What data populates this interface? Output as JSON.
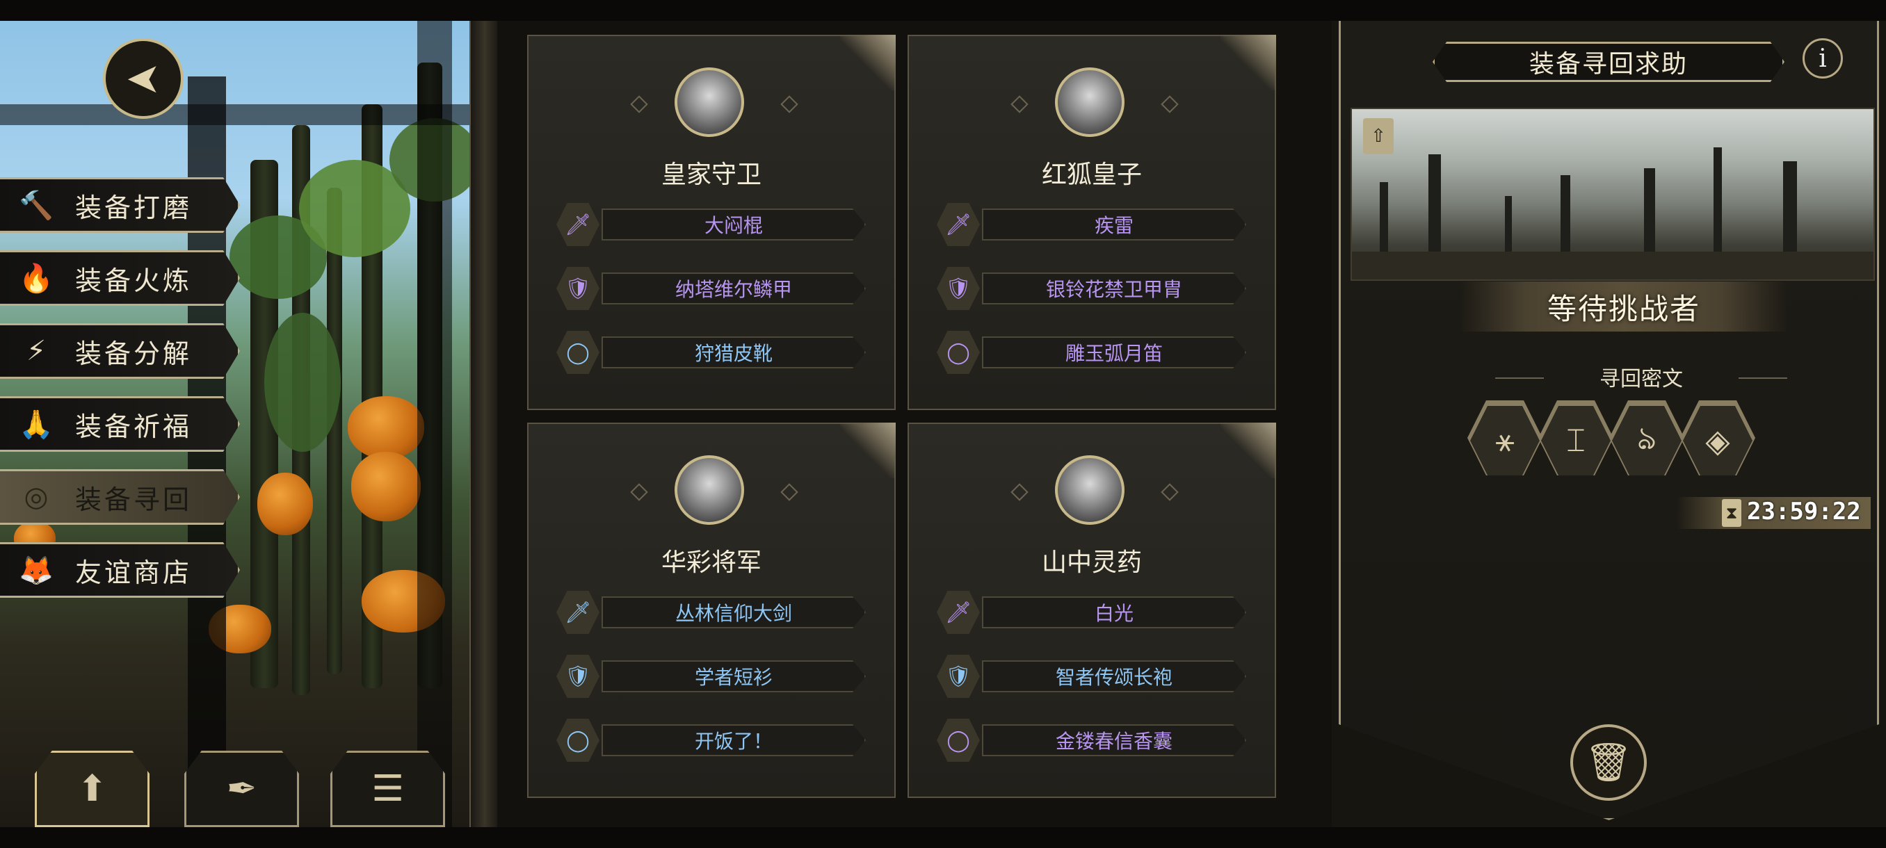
{
  "menu": {
    "items": [
      {
        "label": "装备打磨",
        "icon": "hammer-icon",
        "glyph": "🔨",
        "active": false
      },
      {
        "label": "装备火炼",
        "icon": "flame-icon",
        "glyph": "🔥",
        "active": false
      },
      {
        "label": "装备分解",
        "icon": "decompose-icon",
        "glyph": "⚡",
        "active": false
      },
      {
        "label": "装备祈福",
        "icon": "pray-icon",
        "glyph": "🙏",
        "active": false
      },
      {
        "label": "装备寻回",
        "icon": "target-icon",
        "glyph": "◎",
        "active": true
      },
      {
        "label": "友谊商店",
        "icon": "fox-icon",
        "glyph": "🦊",
        "active": false
      }
    ]
  },
  "back_glyph": "➤",
  "cards": [
    {
      "name": "皇家守卫",
      "items": [
        {
          "label": "大闷棍",
          "type": "weapon",
          "glyph": "🗡",
          "color": "purple"
        },
        {
          "label": "纳塔维尔鳞甲",
          "type": "armor",
          "glyph": "🛡",
          "color": "purple"
        },
        {
          "label": "狩猎皮靴",
          "type": "accessory",
          "glyph": "◯",
          "color": "blue"
        }
      ]
    },
    {
      "name": "红狐皇子",
      "items": [
        {
          "label": "疾雷",
          "type": "weapon",
          "glyph": "🗡",
          "color": "purple"
        },
        {
          "label": "银铃花禁卫甲胄",
          "type": "armor",
          "glyph": "🛡",
          "color": "purple"
        },
        {
          "label": "雕玉弧月笛",
          "type": "accessory",
          "glyph": "◯",
          "color": "purple"
        }
      ]
    },
    {
      "name": "华彩将军",
      "items": [
        {
          "label": "丛林信仰大剑",
          "type": "weapon",
          "glyph": "🗡",
          "color": "blue"
        },
        {
          "label": "学者短衫",
          "type": "armor",
          "glyph": "🛡",
          "color": "blue"
        },
        {
          "label": "开饭了！",
          "type": "accessory",
          "glyph": "◯",
          "color": "blue"
        }
      ]
    },
    {
      "name": "山中灵药",
      "items": [
        {
          "label": "白光",
          "type": "weapon",
          "glyph": "🗡",
          "color": "purple"
        },
        {
          "label": "智者传颂长袍",
          "type": "armor",
          "glyph": "🛡",
          "color": "blue"
        },
        {
          "label": "金镂春信香囊",
          "type": "accessory",
          "glyph": "◯",
          "color": "purple"
        }
      ]
    }
  ],
  "right_panel": {
    "title": "装备寻回求助",
    "info_glyph": "i",
    "banner_icon_glyph": "⇧",
    "status": "等待挑战者",
    "cipher_label": "寻回密文",
    "runes": [
      "⚹",
      "⌶",
      "ঌ",
      "◈"
    ],
    "timer_glyph": "⧗",
    "timer": "23:59:22",
    "trash_glyph": "🗑"
  },
  "bottom_buttons": [
    {
      "icon": "upload-icon",
      "glyph": "⬆",
      "active": true
    },
    {
      "icon": "feather-icon",
      "glyph": "✒",
      "active": false
    },
    {
      "icon": "list-icon",
      "glyph": "☰",
      "active": false
    }
  ]
}
